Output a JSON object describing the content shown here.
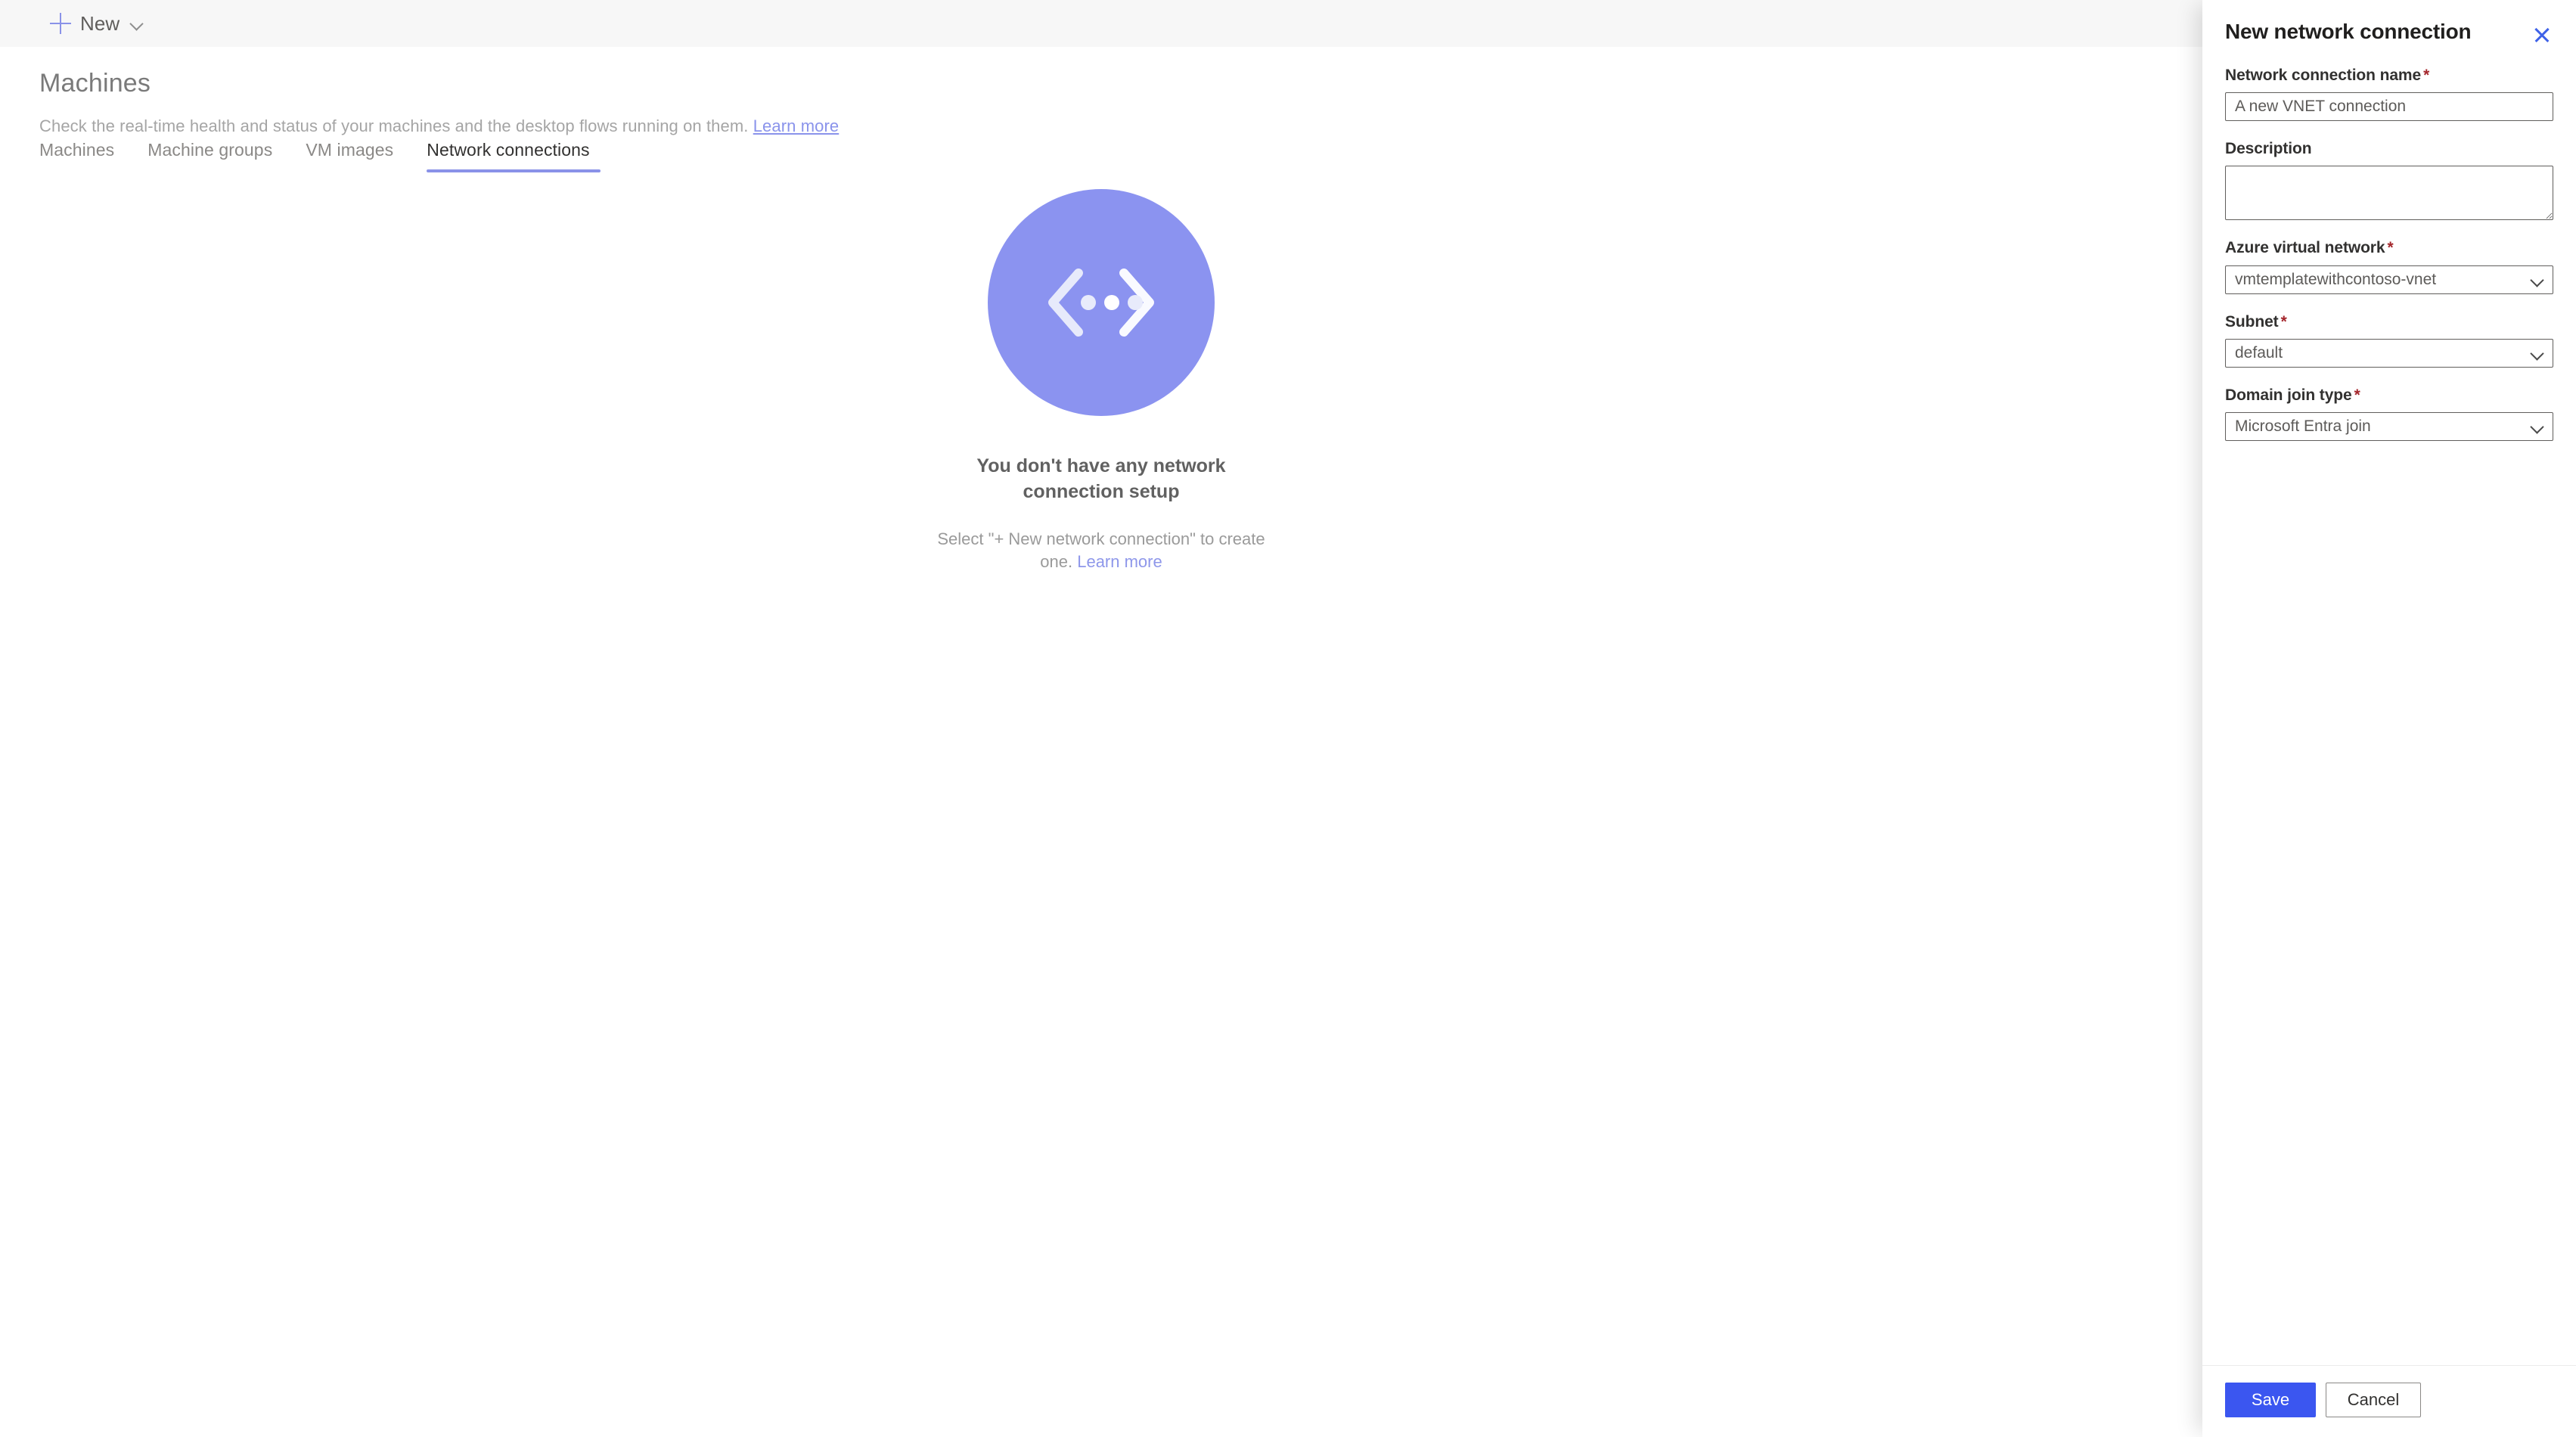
{
  "commandbar": {
    "new_label": "New",
    "plus_icon": "plus-icon",
    "chevron_icon": "chevron-down-icon"
  },
  "header": {
    "title": "Machines",
    "subtitle": "Check the real-time health and status of your machines and the desktop flows running on them.",
    "learn_more": "Learn more"
  },
  "tabs": [
    {
      "label": "Machines",
      "active": false
    },
    {
      "label": "Machine groups",
      "active": false
    },
    {
      "label": "VM images",
      "active": false
    },
    {
      "label": "Network connections",
      "active": true
    }
  ],
  "empty_state": {
    "illustration_icon": "network-connection-illustration",
    "title": "You don't have any network connection setup",
    "description": "Select \"+ New network connection\" to create one.",
    "learn_more": "Learn more"
  },
  "panel": {
    "title": "New network connection",
    "close_icon": "close-icon",
    "fields": {
      "name": {
        "label": "Network connection name",
        "required": "*",
        "value": "A new VNET connection",
        "placeholder": ""
      },
      "description": {
        "label": "Description",
        "required": "",
        "value": "",
        "placeholder": ""
      },
      "vnet": {
        "label": "Azure virtual network",
        "required": "*",
        "value": "vmtemplatewithcontoso-vnet"
      },
      "subnet": {
        "label": "Subnet",
        "required": "*",
        "value": "default"
      },
      "domain_join": {
        "label": "Domain join type",
        "required": "*",
        "value": "Microsoft Entra join"
      }
    },
    "footer": {
      "save_label": "Save",
      "cancel_label": "Cancel"
    }
  },
  "colors": {
    "accent_blue": "#3b56f0",
    "periwinkle": "#8a92e8",
    "illustration_bg": "#8b93f0",
    "required_red": "#a4262c",
    "commandbar_bg": "#f7f7f7"
  }
}
